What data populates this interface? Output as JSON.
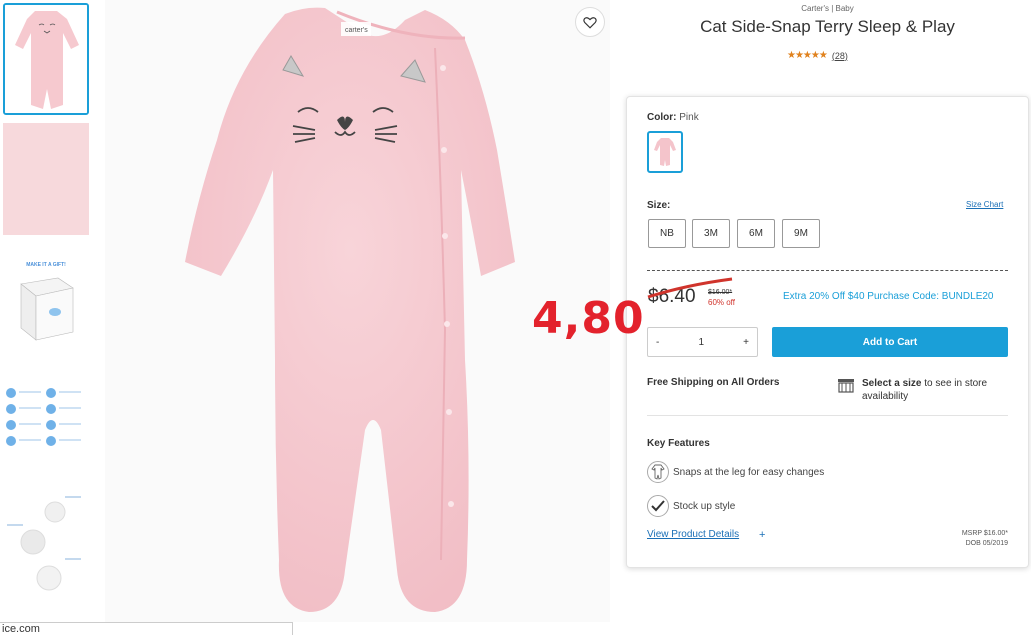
{
  "product": {
    "brand": "Carter's | Baby",
    "title": "Cat Side-Snap Terry Sleep & Play",
    "stars": "★★★★★",
    "review_count": "(28)"
  },
  "status_bar": {
    "url_fragment": "ice.com"
  },
  "gallery": {
    "thumb3_title": "MAKE IT A GIFT!"
  },
  "color": {
    "label": "Color:",
    "value": "Pink"
  },
  "size": {
    "label": "Size:",
    "chart_link": "Size Chart",
    "options": [
      "NB",
      "3M",
      "6M",
      "9M"
    ]
  },
  "pricing": {
    "price": "$6.40",
    "was": "$16.00*",
    "discount": "60% off",
    "promo": "Extra 20% Off $40 Purchase Code: BUNDLE20",
    "overlay": "4,80"
  },
  "quantity": {
    "minus": "-",
    "value": "1",
    "plus": "+"
  },
  "cart": {
    "add_label": "Add to Cart"
  },
  "shipping": {
    "free": "Free Shipping on All Orders",
    "store_bold": "Select a size",
    "store_rest": " to see in store availability"
  },
  "features": {
    "title": "Key Features",
    "items": [
      "Snaps at the leg for easy changes",
      "Stock up style"
    ]
  },
  "details": {
    "link": "View Product Details",
    "plus": "+",
    "msrp": "MSRP $16.00*",
    "dob": "DOB 05/2019"
  },
  "colors": {
    "accent": "#1a9fd8",
    "sale_red": "#d0342c",
    "onesie_pink": "#f6c9cf",
    "overlay_red": "#e3222c"
  }
}
